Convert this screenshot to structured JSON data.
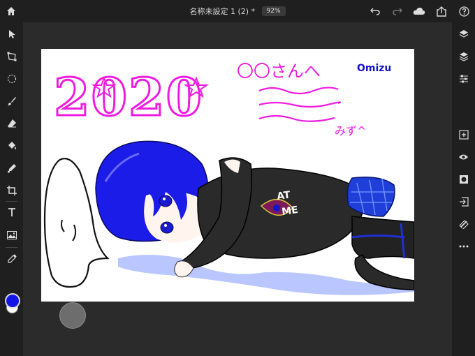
{
  "document": {
    "title": "名称未設定 1 (2) *",
    "zoom": "92%"
  },
  "topbar": {
    "icons": [
      "home-icon",
      "undo-icon",
      "redo-icon",
      "cloud-icon",
      "share-icon",
      "help-icon"
    ]
  },
  "left_tools": [
    "select-icon",
    "transform-icon",
    "lasso-icon",
    "brush-icon",
    "eraser-icon",
    "fill-icon",
    "smudge-icon",
    "crop-icon",
    "text-icon",
    "image-icon",
    "eyedropper-icon"
  ],
  "right_tools": [
    "layers-icon",
    "layer-add-icon",
    "layer-properties-icon",
    "add-icon",
    "visibility-icon",
    "mask-icon",
    "import-icon",
    "clear-icon",
    "more-icon"
  ],
  "colors": {
    "foreground": "#1414e6",
    "background": "#ffffff",
    "accent_pink": "#ee1ce0"
  },
  "artwork": {
    "year_text": "2020",
    "greeting_text": "〇〇さんへ",
    "author_text": "Omizu",
    "signature_text": "みず^",
    "shirt_text_line1": "AT",
    "shirt_text_line2": "ME"
  }
}
